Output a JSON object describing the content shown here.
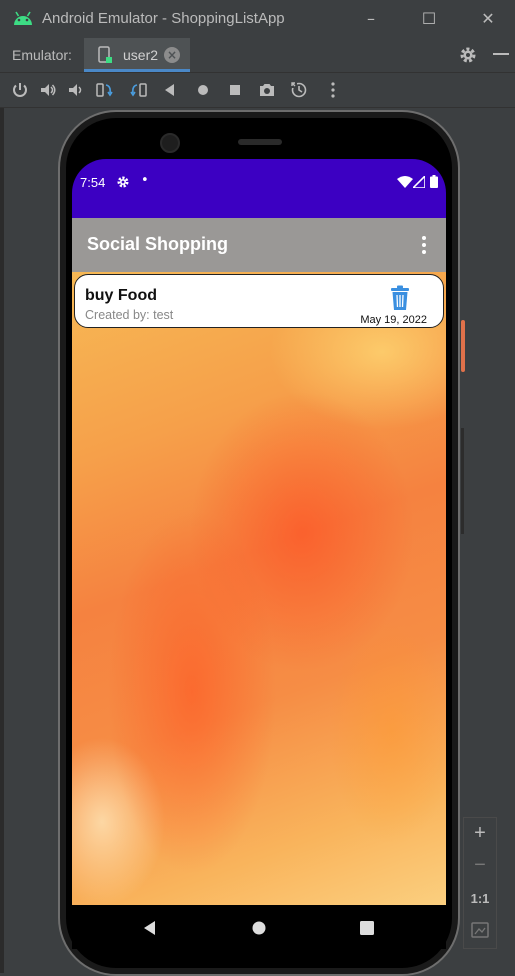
{
  "window": {
    "title": "Android Emulator - ShoppingListApp",
    "minimize_glyph": "–",
    "maximize_glyph": "☐",
    "close_glyph": "✕"
  },
  "tabs": {
    "label": "Emulator:",
    "active_tab": "user2",
    "close_glyph": "×"
  },
  "toolbar": {
    "icons": [
      "power-icon",
      "volume-up-icon",
      "volume-down-icon",
      "rotate-left-icon",
      "rotate-right-icon",
      "back-icon",
      "home-icon",
      "overview-icon",
      "screenshot-icon",
      "snapshot-icon",
      "more-icon"
    ]
  },
  "side_controls": {
    "zoom_in": "+",
    "zoom_out": "−",
    "actual_size": "1:1"
  },
  "device": {
    "status_bar": {
      "time": "7:54",
      "dot": "•"
    },
    "app_bar": {
      "title": "Social Shopping"
    },
    "list": [
      {
        "title": "buy Food",
        "created_by": "Created by: test",
        "date": "May 19, 2022"
      }
    ]
  },
  "colors": {
    "status_bar": "#3c00c2",
    "app_bar": "#9a9896",
    "fab": "#12d1c0",
    "trash": "#3a8fe0",
    "ide_bg": "#3c3f41"
  }
}
